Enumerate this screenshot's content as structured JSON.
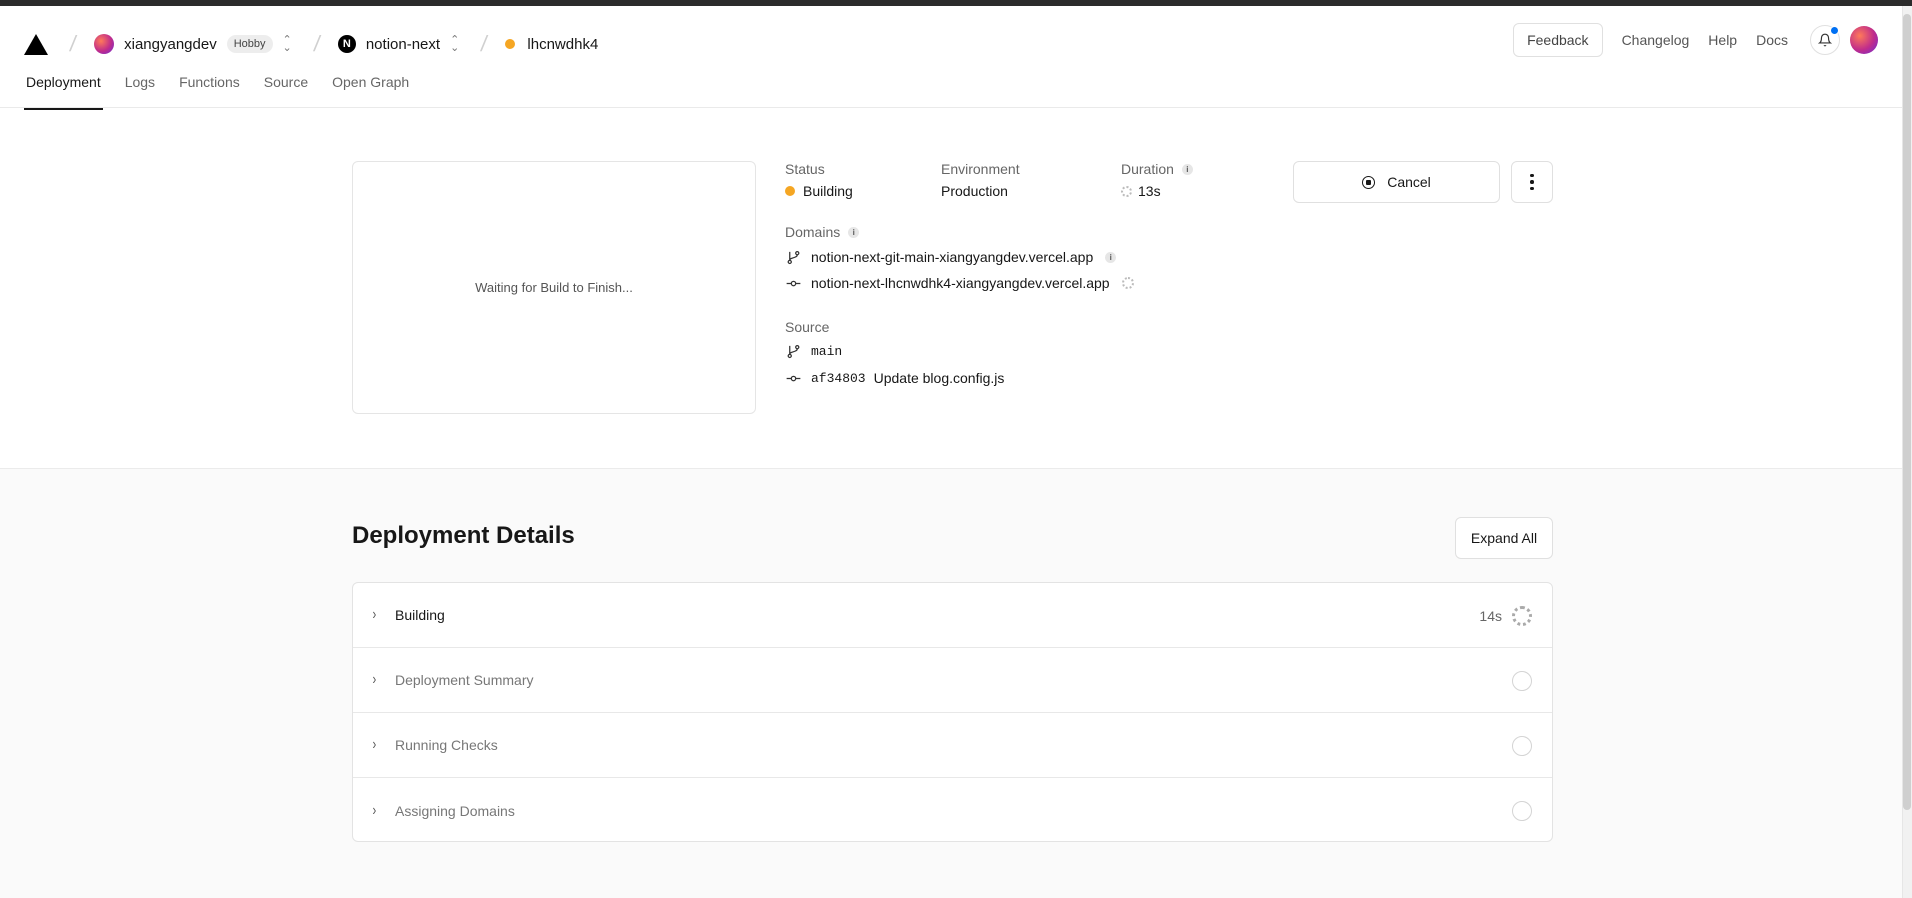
{
  "header": {
    "team_name": "xiangyangdev",
    "plan_badge": "Hobby",
    "project_name": "notion-next",
    "project_logo_letter": "N",
    "deployment_id": "lhcnwdhk4",
    "feedback_label": "Feedback",
    "links": [
      "Changelog",
      "Help",
      "Docs"
    ]
  },
  "tabs": [
    "Deployment",
    "Logs",
    "Functions",
    "Source",
    "Open Graph"
  ],
  "active_tab": "Deployment",
  "preview": {
    "text": "Waiting for Build to Finish..."
  },
  "meta": {
    "status_label": "Status",
    "status_value": "Building",
    "environment_label": "Environment",
    "environment_value": "Production",
    "duration_label": "Duration",
    "duration_value": "13s",
    "domains_label": "Domains",
    "domains": [
      "notion-next-git-main-xiangyangdev.vercel.app",
      "notion-next-lhcnwdhk4-xiangyangdev.vercel.app"
    ],
    "source_label": "Source",
    "branch": "main",
    "commit_hash": "af34803",
    "commit_message": "Update blog.config.js"
  },
  "actions": {
    "cancel_label": "Cancel"
  },
  "details": {
    "title": "Deployment Details",
    "expand_label": "Expand All",
    "steps": [
      {
        "label": "Building",
        "time": "14s",
        "state": "running"
      },
      {
        "label": "Deployment Summary",
        "state": "pending"
      },
      {
        "label": "Running Checks",
        "state": "pending"
      },
      {
        "label": "Assigning Domains",
        "state": "pending"
      }
    ]
  },
  "colors": {
    "status_building": "#f5a623",
    "notification": "#0070f3"
  }
}
